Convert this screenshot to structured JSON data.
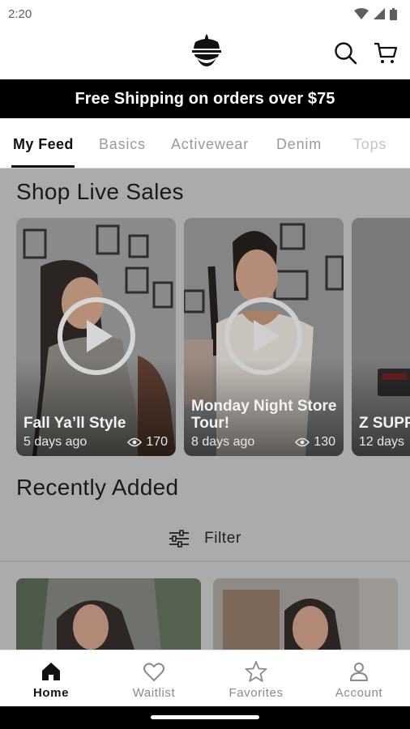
{
  "status_bar": {
    "time": "2:20"
  },
  "app_bar": {
    "logo": "brand-logo",
    "icons": [
      "search-icon",
      "cart-icon"
    ]
  },
  "banner": {
    "text": "Free Shipping on orders over $75"
  },
  "tabs": [
    {
      "label": "My Feed",
      "active": true
    },
    {
      "label": "Basics",
      "active": false
    },
    {
      "label": "Activewear",
      "active": false
    },
    {
      "label": "Denim",
      "active": false
    },
    {
      "label": "Tops",
      "active": false
    }
  ],
  "live_sales": {
    "title": "Shop Live Sales",
    "cards": [
      {
        "title": "Fall Ya’ll Style",
        "age": "5 days ago",
        "views": "170"
      },
      {
        "title": "Monday Night Store Tour!",
        "age": "8 days ago",
        "views": "130"
      },
      {
        "title": "Z SUPP",
        "age": "12 days",
        "views": ""
      }
    ]
  },
  "recently_added": {
    "title": "Recently Added",
    "filter_label": "Filter"
  },
  "bottom_nav": [
    {
      "label": "Home",
      "active": true
    },
    {
      "label": "Waitlist",
      "active": false
    },
    {
      "label": "Favorites",
      "active": false
    },
    {
      "label": "Account",
      "active": false
    }
  ],
  "colors": {
    "banner_bg": "#000000",
    "overlay": "#ababab",
    "active_text": "#111111",
    "inactive_text": "#9a9a9a"
  }
}
